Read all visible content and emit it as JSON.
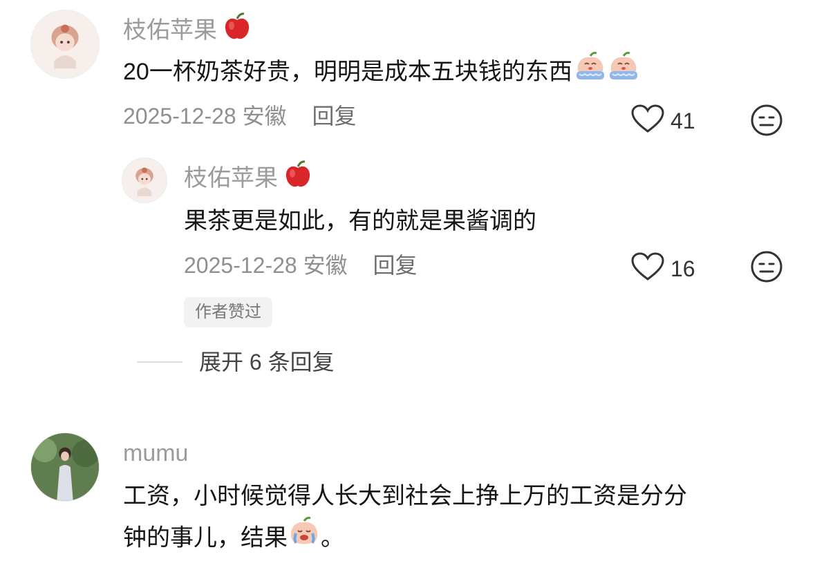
{
  "comments": [
    {
      "username": "枝佑苹果",
      "text": "20一杯奶茶好贵，明明是成本五块钱的东西",
      "date": "2025-12-28",
      "region": "安徽",
      "reply_label": "回复",
      "likes": "41",
      "reply": {
        "username": "枝佑苹果",
        "text": "果茶更是如此，有的就是果酱调的",
        "date": "2025-12-28",
        "region": "安徽",
        "reply_label": "回复",
        "likes": "16",
        "badge": "作者赞过"
      },
      "expand_label": "展开 6 条回复"
    },
    {
      "username": "mumu",
      "text_line1": "工资，小时候觉得人长大到社会上挣上万的工资是分分",
      "text_line2_pre": "钟的事儿，结果",
      "text_line2_post": "。"
    }
  ],
  "icons": {
    "heart": "heart-icon",
    "dislike": "neutral-face-icon",
    "apple": "apple-emoji",
    "crying": "crying-peach-emoji"
  },
  "colors": {
    "username": "#9b9b9b",
    "meta": "#8f8f8f",
    "text": "#161616",
    "badge_bg": "#f2f2f2"
  }
}
